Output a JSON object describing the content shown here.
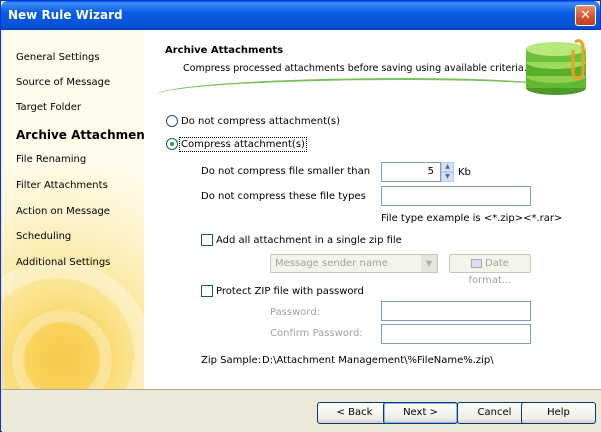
{
  "window": {
    "title": "New Rule Wizard",
    "close_label": "✕"
  },
  "sidebar": {
    "items": [
      {
        "label": "General Settings"
      },
      {
        "label": "Source of Message"
      },
      {
        "label": "Target Folder"
      },
      {
        "label": "Archive Attachments"
      },
      {
        "label": "File Renaming"
      },
      {
        "label": "Filter Attachments"
      },
      {
        "label": "Action on Message"
      },
      {
        "label": "Scheduling"
      },
      {
        "label": "Additional Settings"
      }
    ],
    "active_index": 3
  },
  "header": {
    "title": "Archive Attachments",
    "subtitle": "Compress processed attachments before saving using available criteria."
  },
  "options": {
    "no_compress_label": "Do not compress attachment(s)",
    "compress_label": "Compress attachment(s)",
    "selected": "compress"
  },
  "compress": {
    "min_size_label": "Do not compress file smaller than",
    "min_size_value": "5",
    "min_size_unit": "Kb",
    "exclude_types_label": "Do not compress these file types",
    "exclude_types_value": "",
    "file_type_example": "File type example is <*.zip><*.rar>",
    "single_zip_label": "Add all attachment in a single zip file",
    "single_zip_checked": false,
    "zip_name_value": "Message sender name",
    "date_format_label": "Date format...",
    "protect_label": "Protect ZIP file with password",
    "protect_checked": false,
    "password_label": "Password:",
    "confirm_password_label": "Confirm Password:",
    "zip_sample_label": "Zip Sample:",
    "zip_sample_value": "D:\\Attachment Management\\%FileName%.zip\\"
  },
  "footer": {
    "back_label": "< Back",
    "next_label": "Next >",
    "cancel_label": "Cancel",
    "help_label": "Help"
  },
  "colors": {
    "title_bar": "#0a5de8",
    "sidebar": "#f9d15a",
    "accent_green": "#7cc05b"
  },
  "icons": [
    "close-icon",
    "chevron-down-icon",
    "calendar-icon",
    "archive-logo"
  ]
}
